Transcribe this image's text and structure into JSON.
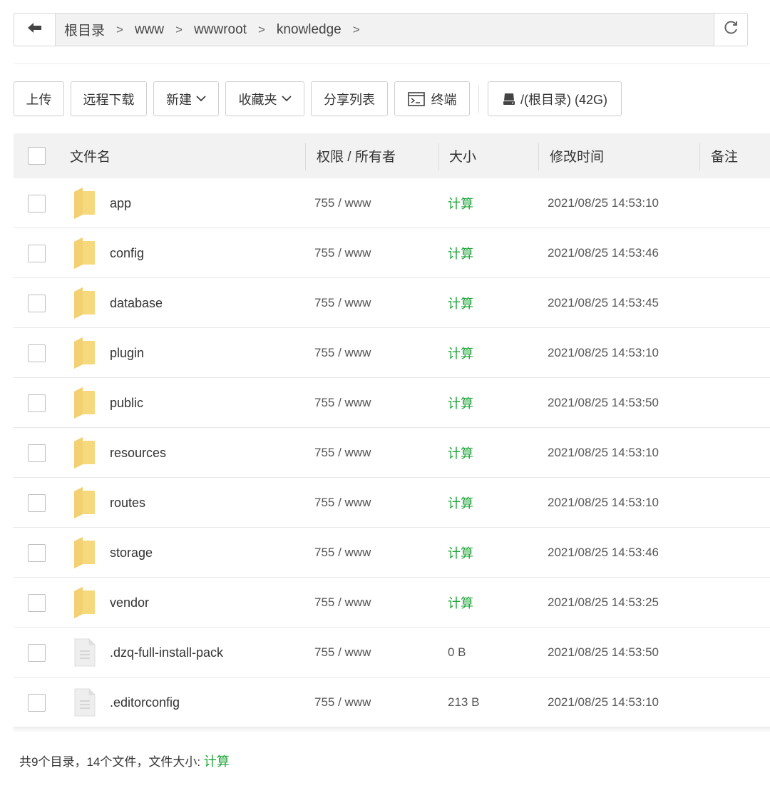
{
  "pathbar": {
    "back_icon": "arrow-left-icon",
    "crumbs": [
      "根目录",
      "www",
      "wwwroot",
      "knowledge"
    ],
    "refresh_icon": "refresh-icon"
  },
  "toolbar": {
    "upload": "上传",
    "remote_download": "远程下载",
    "new": "新建",
    "favorites": "收藏夹",
    "share_list": "分享列表",
    "terminal": "终端",
    "disk": "/(根目录) (42G)"
  },
  "table": {
    "headers": {
      "name": "文件名",
      "perm": "权限 / 所有者",
      "size": "大小",
      "mtime": "修改时间",
      "note": "备注"
    },
    "rows": [
      {
        "name": "app",
        "type": "folder",
        "perm": "755 / www",
        "size": "计算",
        "mtime": "2021/08/25 14:53:10"
      },
      {
        "name": "config",
        "type": "folder",
        "perm": "755 / www",
        "size": "计算",
        "mtime": "2021/08/25 14:53:46"
      },
      {
        "name": "database",
        "type": "folder",
        "perm": "755 / www",
        "size": "计算",
        "mtime": "2021/08/25 14:53:45"
      },
      {
        "name": "plugin",
        "type": "folder",
        "perm": "755 / www",
        "size": "计算",
        "mtime": "2021/08/25 14:53:10"
      },
      {
        "name": "public",
        "type": "folder",
        "perm": "755 / www",
        "size": "计算",
        "mtime": "2021/08/25 14:53:50"
      },
      {
        "name": "resources",
        "type": "folder",
        "perm": "755 / www",
        "size": "计算",
        "mtime": "2021/08/25 14:53:10"
      },
      {
        "name": "routes",
        "type": "folder",
        "perm": "755 / www",
        "size": "计算",
        "mtime": "2021/08/25 14:53:10"
      },
      {
        "name": "storage",
        "type": "folder",
        "perm": "755 / www",
        "size": "计算",
        "mtime": "2021/08/25 14:53:46"
      },
      {
        "name": "vendor",
        "type": "folder",
        "perm": "755 / www",
        "size": "计算",
        "mtime": "2021/08/25 14:53:25"
      },
      {
        "name": ".dzq-full-install-pack",
        "type": "file",
        "perm": "755 / www",
        "size": "0 B",
        "mtime": "2021/08/25 14:53:50"
      },
      {
        "name": ".editorconfig",
        "type": "file",
        "perm": "755 / www",
        "size": "213 B",
        "mtime": "2021/08/25 14:53:10"
      }
    ]
  },
  "footer": {
    "summary": "共9个目录，14个文件，文件大小: ",
    "calc_link": "计算"
  },
  "colors": {
    "accent_green": "#20a53a",
    "folder_yellow": "#f5d77a"
  }
}
